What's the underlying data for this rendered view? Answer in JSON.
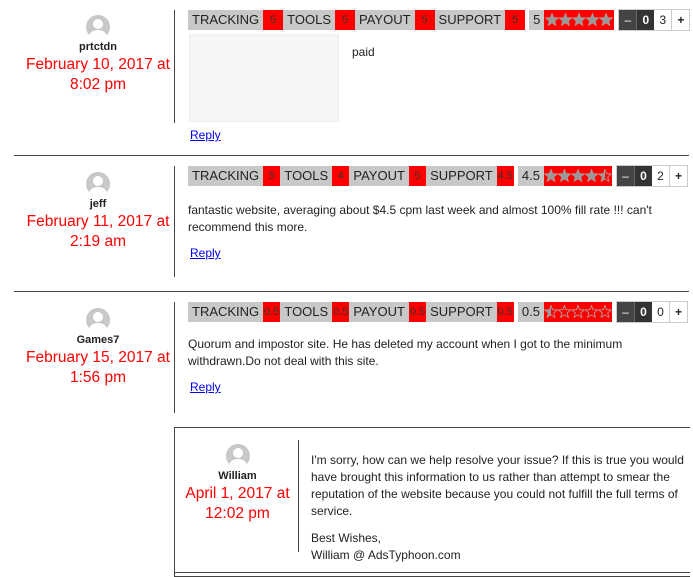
{
  "rating_labels": [
    "TRACKING",
    "TOOLS",
    "PAYOUT",
    "SUPPORT"
  ],
  "colors": {
    "accent": "#ff0000",
    "label_bg": "#c8c8c8",
    "link": "#0000ee",
    "vote_dark": "#444444"
  },
  "comments": [
    {
      "author": "prtctdn",
      "date_line1": "February 10, 2017 at",
      "date_line2": "8:02 pm",
      "ratings": [
        "5",
        "5",
        "5",
        "5"
      ],
      "average": "5",
      "stars_fraction": 1.0,
      "vote": {
        "minus": "–",
        "score": "0",
        "count": "3",
        "plus": "+"
      },
      "has_screenshot": true,
      "text": "paid",
      "reply": "Reply"
    },
    {
      "author": "jeff",
      "date_line1": "February 11, 2017 at",
      "date_line2": "2:19 am",
      "ratings": [
        "5",
        "4",
        "5",
        "4.5"
      ],
      "average": "4.5",
      "stars_fraction": 0.9,
      "vote": {
        "minus": "–",
        "score": "0",
        "count": "2",
        "plus": "+"
      },
      "text": "fantastic website, averaging about $4.5 cpm last week and almost 100% fill rate !!! can't recommend this more.",
      "reply": "Reply"
    },
    {
      "author": "Games7",
      "date_line1": "February 15, 2017 at",
      "date_line2": "1:56 pm",
      "ratings": [
        "0.5",
        "0.5",
        "0.5",
        "0.5"
      ],
      "average": "0.5",
      "stars_fraction": 0.1,
      "vote": {
        "minus": "–",
        "score": "0",
        "count": "0",
        "plus": "+"
      },
      "text": "Quorum and impostor site. He has deleted my account when I got to the minimum withdrawn.Do not deal with this site.",
      "reply": "Reply"
    }
  ],
  "child_reply": {
    "author": "William",
    "date_line1": "April 1, 2017 at",
    "date_line2": "12:02 pm",
    "paragraph1": "I'm sorry, how can we help resolve your issue? If this is true you would have brought this information to us rather than attempt to smear the reputation of the website because you could not fulfill the full terms of service.",
    "signoff_line1": "Best Wishes,",
    "signoff_line2": "William @ AdsTyphoon.com"
  }
}
